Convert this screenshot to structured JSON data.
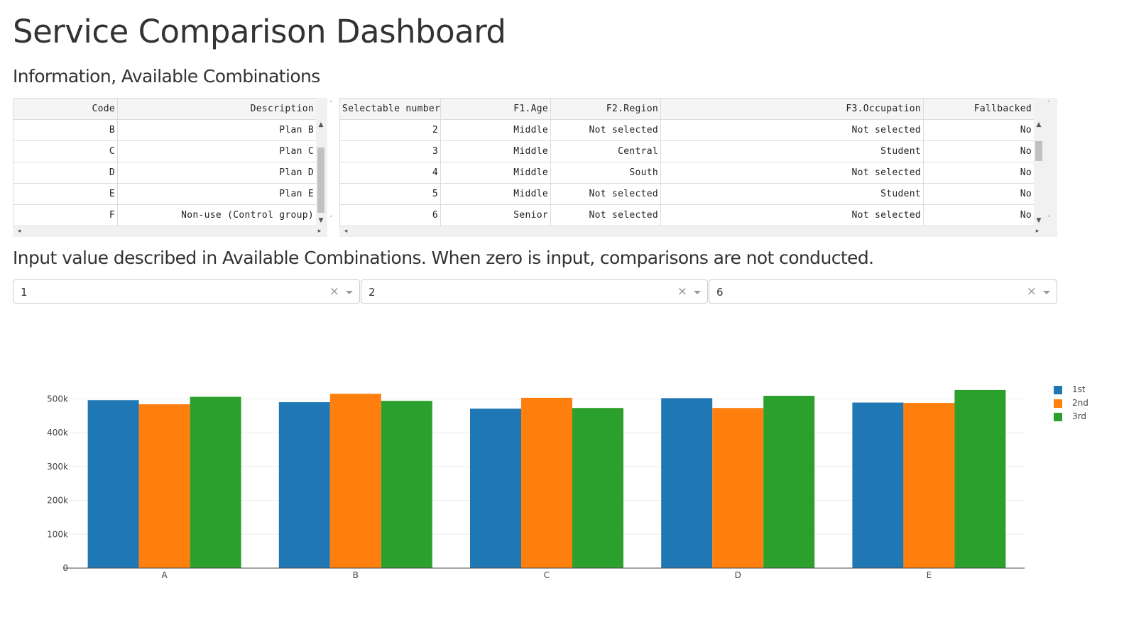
{
  "page": {
    "title": "Service Comparison Dashboard",
    "info_heading": "Information, Available Combinations",
    "input_heading": "Input value described in Available Combinations. When zero is input, comparisons are not conducted."
  },
  "code_table": {
    "columns": [
      "Code",
      "Description"
    ],
    "rows": [
      [
        "B",
        "Plan B"
      ],
      [
        "C",
        "Plan C"
      ],
      [
        "D",
        "Plan D"
      ],
      [
        "E",
        "Plan E"
      ],
      [
        "F",
        "Non-use (Control group)"
      ]
    ]
  },
  "combo_table": {
    "columns": [
      "Selectable number",
      "F1.Age",
      "F2.Region",
      "F3.Occupation",
      "Fallbacked"
    ],
    "rows": [
      [
        "2",
        "Middle",
        "Not selected",
        "Not selected",
        "No"
      ],
      [
        "3",
        "Middle",
        "Central",
        "Student",
        "No"
      ],
      [
        "4",
        "Middle",
        "South",
        "Not selected",
        "No"
      ],
      [
        "5",
        "Middle",
        "Not selected",
        "Student",
        "No"
      ],
      [
        "6",
        "Senior",
        "Not selected",
        "Not selected",
        "No"
      ]
    ]
  },
  "dropdowns": [
    {
      "value": "1",
      "clear": "×"
    },
    {
      "value": "2",
      "clear": "×"
    },
    {
      "value": "6",
      "clear": "×"
    }
  ],
  "colors": {
    "series_1": "#1f77b4",
    "series_2": "#ff7f0e",
    "series_3": "#2ca02c"
  },
  "chart_data": {
    "type": "bar",
    "categories": [
      "A",
      "B",
      "C",
      "D",
      "E"
    ],
    "series": [
      {
        "name": "1st",
        "values": [
          496000,
          490000,
          471000,
          502000,
          489000
        ]
      },
      {
        "name": "2nd",
        "values": [
          484000,
          515000,
          503000,
          473000,
          488000
        ]
      },
      {
        "name": "3rd",
        "values": [
          506000,
          494000,
          473000,
          509000,
          526000
        ]
      }
    ],
    "yticks": [
      "0",
      "100k",
      "200k",
      "300k",
      "400k",
      "500k"
    ],
    "ylim": [
      0,
      530000
    ],
    "grid": true,
    "legend": "top-right"
  }
}
